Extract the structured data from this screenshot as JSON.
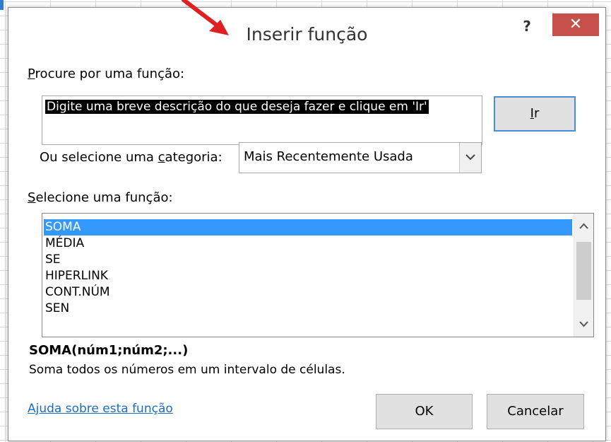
{
  "dialog": {
    "title": "Inserir função",
    "help_label": "?",
    "close_label": "✕"
  },
  "search": {
    "label_access_key": "P",
    "label_rest": "rocure por uma função:",
    "value": "Digite uma breve descrição do que deseja fazer e clique em 'Ir'",
    "go_label_access_key": "I",
    "go_label_rest": "r"
  },
  "category": {
    "label_pre": "Ou selecione uma ",
    "label_access_key": "c",
    "label_post": "ategoria:",
    "selected": "Mais Recentemente Usada"
  },
  "functions": {
    "label_access_key": "S",
    "label_rest": "elecione uma função:",
    "items": [
      "SOMA",
      "MÉDIA",
      "SE",
      "HIPERLINK",
      "CONT.NÚM",
      "SEN"
    ],
    "selected_index": 0
  },
  "details": {
    "syntax": "SOMA(núm1;núm2;...)",
    "description": "Soma todos os números em um intervalo de células."
  },
  "footer": {
    "help_link": "Ajuda sobre esta função",
    "ok_label": "OK",
    "cancel_label": "Cancelar"
  },
  "colors": {
    "selection": "#3399ff",
    "close_button": "#c7504a",
    "link": "#1a6fc4",
    "arrow": "#e02020"
  },
  "icons": {
    "arrow": "red-arrow-icon",
    "combo": "chevron-down-icon",
    "scroll_up": "chevron-up-icon",
    "scroll_down": "chevron-down-icon"
  }
}
